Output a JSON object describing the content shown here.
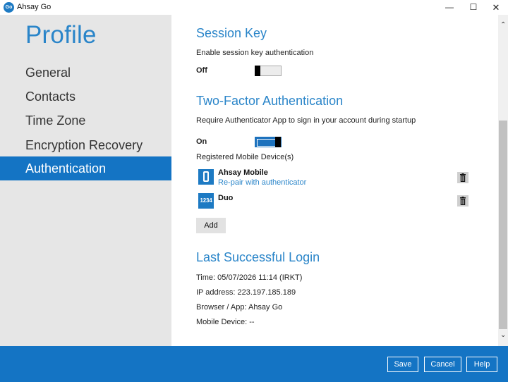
{
  "window": {
    "logo_text": "Go",
    "title": "Ahsay Go",
    "minimize_glyph": "—",
    "maximize_glyph": "☐",
    "close_glyph": "✕"
  },
  "sidebar": {
    "title": "Profile",
    "items": [
      {
        "label": "General",
        "active": false
      },
      {
        "label": "Contacts",
        "active": false
      },
      {
        "label": "Time Zone",
        "active": false
      },
      {
        "label": "Encryption Recovery",
        "active": false
      },
      {
        "label": "Authentication",
        "active": true
      }
    ]
  },
  "session_key": {
    "title": "Session Key",
    "description": "Enable session key authentication",
    "state_label": "Off",
    "enabled": false
  },
  "two_factor": {
    "title": "Two-Factor Authentication",
    "description": "Require Authenticator App to sign in your account during startup",
    "state_label": "On",
    "enabled": true,
    "devices_label": "Registered Mobile Device(s)",
    "devices": [
      {
        "name": "Ahsay Mobile",
        "action": "Re-pair with authenticator",
        "icon": "phone-icon"
      },
      {
        "name": "Duo",
        "icon_text": "1234",
        "icon": "passcode-icon"
      }
    ],
    "add_label": "Add"
  },
  "last_login": {
    "title": "Last Successful Login",
    "time": "Time: 05/07/2026 11:14 (IRKT)",
    "ip": "IP address: 223.197.185.189",
    "browser": "Browser / App: Ahsay Go",
    "mobile": "Mobile Device: --"
  },
  "footer": {
    "save_label": "Save",
    "cancel_label": "Cancel",
    "help_label": "Help"
  },
  "colors": {
    "accent": "#1474c4",
    "heading": "#2a85c9",
    "sidebar_bg": "#e6e6e6"
  }
}
